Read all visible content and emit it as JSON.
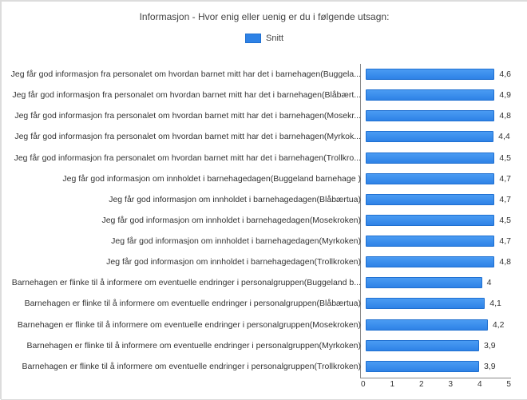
{
  "chart_data": {
    "type": "bar",
    "title": "Informasjon - Hvor enig eller uenig er du i følgende utsagn:",
    "legend": "Snitt",
    "xlabel": "",
    "ylabel": "",
    "xlim": [
      0,
      5
    ],
    "xticks": [
      0,
      1,
      2,
      3,
      4,
      5
    ],
    "categories": [
      "Jeg får god informasjon fra personalet om hvordan barnet mitt har det i barnehagen(Buggela...",
      "Jeg får god informasjon fra personalet om hvordan barnet mitt har det i barnehagen(Blåbært...",
      "Jeg får god informasjon fra personalet om hvordan barnet mitt har det i barnehagen(Mosekr...",
      "Jeg får god informasjon fra personalet om hvordan barnet mitt har det i barnehagen(Myrkok...",
      "Jeg får god informasjon fra personalet om hvordan barnet mitt har det i barnehagen(Trollkro...",
      "Jeg får god informasjon om innholdet i barnehagedagen(Buggeland barnehage )",
      "Jeg får god informasjon om innholdet i barnehagedagen(Blåbærtua)",
      "Jeg får god informasjon om innholdet i barnehagedagen(Mosekroken)",
      "Jeg får god informasjon om innholdet i barnehagedagen(Myrkoken)",
      "Jeg får god informasjon om innholdet i barnehagedagen(Trollkroken)",
      "Barnehagen er flinke til å informere om eventuelle endringer i personalgruppen(Buggeland b...",
      "Barnehagen er flinke til å informere om eventuelle endringer i personalgruppen(Blåbærtua)",
      "Barnehagen er flinke til å informere om eventuelle endringer i personalgruppen(Mosekroken)",
      "Barnehagen er flinke til å informere om eventuelle endringer i personalgruppen(Myrkoken)",
      "Barnehagen er flinke til å informere om eventuelle endringer i personalgruppen(Trollkroken)"
    ],
    "values": [
      4.6,
      4.9,
      4.8,
      4.4,
      4.5,
      4.7,
      4.7,
      4.5,
      4.7,
      4.8,
      4,
      4.1,
      4.2,
      3.9,
      3.9
    ],
    "value_labels": [
      "4,6",
      "4,9",
      "4,8",
      "4,4",
      "4,5",
      "4,7",
      "4,7",
      "4,5",
      "4,7",
      "4,8",
      "4",
      "4,1",
      "4,2",
      "3,9",
      "3,9"
    ]
  }
}
